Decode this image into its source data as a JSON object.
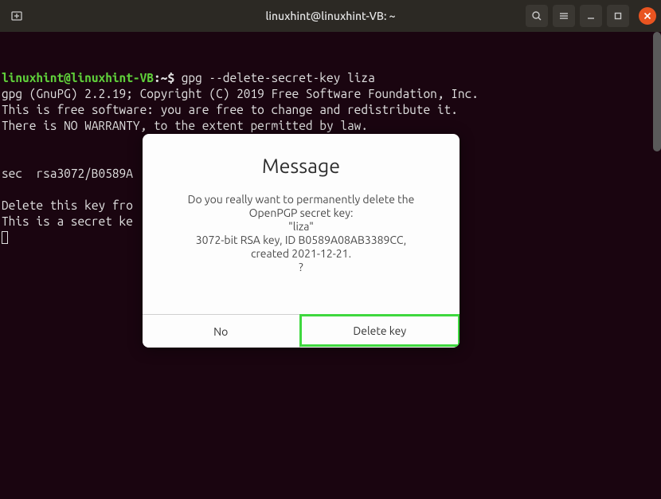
{
  "titlebar": {
    "title": "linuxhint@linuxhint-VB: ~"
  },
  "terminal": {
    "prompt_user": "linuxhint@linuxhint-VB",
    "prompt_path": ":~$ ",
    "command": "gpg --delete-secret-key liza",
    "line2": "gpg (GnuPG) 2.2.19; Copyright (C) 2019 Free Software Foundation, Inc.",
    "line3": "This is free software: you are free to change and redistribute it.",
    "line4": "There is NO WARRANTY, to the extent permitted by law.",
    "line5": "",
    "line6": "",
    "line7": "sec  rsa3072/B0589A",
    "line8": "",
    "line9": "Delete this key fro",
    "line10": "This is a secret ke"
  },
  "dialog": {
    "title": "Message",
    "text_l1": "Do you really want to permanently delete the",
    "text_l2": "OpenPGP secret key:",
    "text_l3": "\"liza\"",
    "text_l4": "3072-bit RSA key, ID B0589A08AB3389CC,",
    "text_l5": "created 2021-12-21.",
    "text_l6": "?",
    "no_label": "No",
    "delete_label": "Delete key"
  }
}
